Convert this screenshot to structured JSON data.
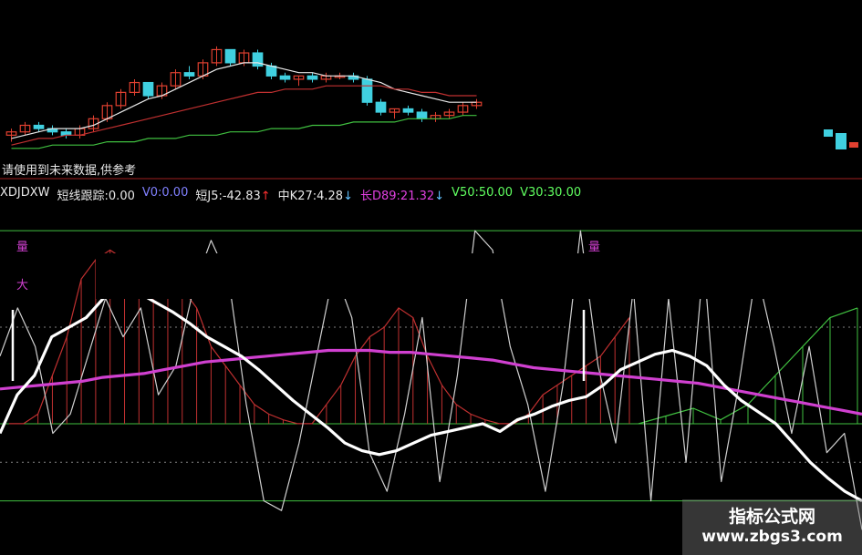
{
  "note": "请使用到未来数据,供参考",
  "indicator": {
    "name": "XDJDXW",
    "items": [
      {
        "text": "短线跟踪:0.00",
        "color": "#e8e8e8"
      },
      {
        "text": "V0:0.00",
        "color": "#8080ff"
      },
      {
        "text": "短J5:-42.83",
        "color": "#e8e8e8",
        "arrow": "↑",
        "arrow_color": "#ff3030"
      },
      {
        "text": "中K27:4.28",
        "color": "#e8e8e8",
        "arrow": "↓",
        "arrow_color": "#60c0ff"
      },
      {
        "text": "长D89:21.32",
        "color": "#e040e0",
        "arrow": "↓",
        "arrow_color": "#60c0ff"
      },
      {
        "text": "V50:50.00",
        "color": "#60ff60"
      },
      {
        "text": "V30:30.00",
        "color": "#60ff60"
      }
    ]
  },
  "markers": {
    "left_a": "量",
    "left_b": "大",
    "right_a": "量"
  },
  "watermark": {
    "line1": "指标公式网",
    "line2": "www.zbgs3.com"
  },
  "colors": {
    "up": "#e04030",
    "down": "#40d0e0",
    "ma_white": "#e8e8e8",
    "ma_red": "#c03030",
    "ma_green": "#40c040",
    "short": "#d0d0d0",
    "mid": "#ffffff",
    "long": "#d040d0",
    "hist_red": "#c03030",
    "hist_green": "#40c040",
    "level": "#40c040"
  },
  "chart_data": [
    {
      "type": "candlestick",
      "title": "",
      "candles": [
        [
          100,
          102,
          98,
          101
        ],
        [
          101,
          104,
          100,
          103
        ],
        [
          103,
          104,
          101,
          102
        ],
        [
          102,
          103,
          100,
          101
        ],
        [
          101,
          102,
          99,
          100
        ],
        [
          100,
          103,
          99,
          102
        ],
        [
          102,
          106,
          101,
          105
        ],
        [
          105,
          110,
          104,
          109
        ],
        [
          109,
          114,
          108,
          113
        ],
        [
          113,
          117,
          112,
          116
        ],
        [
          116,
          115,
          111,
          112
        ],
        [
          112,
          116,
          111,
          115
        ],
        [
          115,
          120,
          114,
          119
        ],
        [
          119,
          121,
          117,
          118
        ],
        [
          118,
          123,
          117,
          122
        ],
        [
          122,
          127,
          121,
          126
        ],
        [
          126,
          125,
          121,
          122
        ],
        [
          122,
          126,
          121,
          125
        ],
        [
          125,
          126,
          120,
          121
        ],
        [
          121,
          122,
          117,
          118
        ],
        [
          118,
          119,
          116,
          117
        ],
        [
          117,
          118,
          115,
          118
        ],
        [
          118,
          119,
          116,
          117
        ],
        [
          117,
          119,
          116,
          118
        ],
        [
          118,
          119,
          117,
          118
        ],
        [
          118,
          119,
          116,
          117
        ],
        [
          117,
          118,
          109,
          110
        ],
        [
          110,
          111,
          106,
          107
        ],
        [
          107,
          108,
          105,
          108
        ],
        [
          108,
          109,
          106,
          107
        ],
        [
          107,
          108,
          104,
          105
        ],
        [
          105,
          107,
          104,
          106
        ],
        [
          106,
          108,
          105,
          107
        ],
        [
          107,
          110,
          106,
          109
        ],
        [
          109,
          111,
          108,
          110
        ]
      ],
      "ma": [
        {
          "values": [
            99,
            100,
            101,
            102,
            102,
            102,
            103,
            105,
            107,
            109,
            111,
            112,
            114,
            116,
            118,
            120,
            121,
            122,
            122,
            121,
            120,
            119,
            119,
            118,
            118,
            118,
            117,
            116,
            114,
            113,
            112,
            111,
            110,
            110,
            110
          ]
        },
        {
          "values": [
            97,
            98,
            99,
            99,
            100,
            100,
            101,
            102,
            103,
            104,
            105,
            106,
            107,
            108,
            109,
            110,
            111,
            112,
            113,
            113,
            114,
            114,
            114,
            115,
            115,
            115,
            115,
            115,
            114,
            114,
            113,
            113,
            112,
            112,
            112
          ]
        },
        {
          "values": [
            96,
            96,
            96,
            97,
            97,
            97,
            97,
            98,
            98,
            98,
            99,
            99,
            99,
            100,
            100,
            100,
            101,
            101,
            101,
            102,
            102,
            102,
            103,
            103,
            103,
            104,
            104,
            104,
            104,
            105,
            105,
            105,
            105,
            106,
            106
          ]
        }
      ]
    },
    {
      "type": "line",
      "title": "",
      "ylim": [
        -60,
        110
      ],
      "levels": [
        100,
        50,
        0,
        -20,
        -40
      ],
      "series": [
        {
          "name": "短J5",
          "values": [
            35,
            60,
            40,
            -5,
            5,
            35,
            65,
            45,
            60,
            15,
            30,
            70,
            95,
            75,
            10,
            -40,
            -45,
            -10,
            35,
            80,
            55,
            -15,
            -35,
            5,
            55,
            -30,
            25,
            100,
            90,
            40,
            10,
            -35,
            20,
            100,
            30,
            -10,
            70,
            -40,
            65,
            -20,
            85,
            -30,
            20,
            80,
            40,
            -5,
            40,
            -15,
            -5,
            -55
          ]
        },
        {
          "name": "中K27",
          "values": [
            -5,
            15,
            25,
            45,
            50,
            55,
            65,
            72,
            68,
            63,
            58,
            52,
            45,
            40,
            35,
            28,
            20,
            12,
            5,
            -2,
            -10,
            -14,
            -16,
            -14,
            -10,
            -6,
            -4,
            -2,
            0,
            -4,
            2,
            5,
            9,
            12,
            14,
            20,
            28,
            32,
            36,
            38,
            35,
            30,
            20,
            12,
            6,
            0,
            -10,
            -20,
            -28,
            -35,
            -40
          ]
        },
        {
          "name": "长D89",
          "values": [
            18,
            19,
            20,
            21,
            22,
            24,
            25,
            26,
            28,
            30,
            32,
            33,
            34,
            35,
            36,
            37,
            38,
            38,
            38,
            37,
            37,
            36,
            35,
            34,
            33,
            31,
            29,
            28,
            27,
            26,
            25,
            24,
            23,
            22,
            21,
            19,
            17,
            15,
            13,
            11,
            9,
            7,
            5
          ]
        },
        {
          "name": "短线跟踪",
          "values": [
            0,
            0,
            5,
            25,
            45,
            75,
            85,
            90,
            85,
            82,
            82,
            80,
            70,
            60,
            40,
            30,
            20,
            10,
            5,
            2,
            0,
            0,
            10,
            20,
            35,
            45,
            50,
            60,
            55,
            35,
            20,
            10,
            5,
            2,
            0,
            0,
            5,
            15,
            20,
            25,
            30,
            35,
            45,
            55
          ]
        }
      ]
    }
  ]
}
